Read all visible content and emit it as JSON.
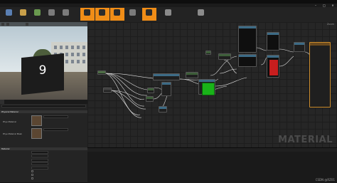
{
  "window": {
    "menu": [],
    "controls": [
      "–",
      "□",
      "✕"
    ]
  },
  "toolbar": {
    "buttons": [
      {
        "label": "",
        "icon": "save-icon"
      },
      {
        "label": "",
        "icon": "folder-icon"
      },
      {
        "label": "",
        "icon": "apply-icon"
      },
      {
        "label": "",
        "icon": "search-icon"
      },
      {
        "label": "",
        "icon": "home-icon"
      },
      {
        "label": "",
        "icon": "clean-icon"
      },
      {
        "label": "",
        "icon": "connectors-icon"
      },
      {
        "label": "",
        "icon": "live-preview-icon"
      },
      {
        "label": "",
        "icon": "live-nodes-icon"
      },
      {
        "label": "",
        "icon": "live-update-icon"
      },
      {
        "label": "",
        "icon": "hlsl-icon"
      },
      {
        "label": "",
        "icon": "platform-icon"
      }
    ],
    "accent_color": "#f08d17"
  },
  "viewport": {
    "chips": [
      "",
      "",
      ""
    ],
    "preview_number": "9"
  },
  "details": {
    "tabs": [
      "",
      ""
    ],
    "section_physical": "Physical Material",
    "prop_phys_material": "Phys Material",
    "prop_phys_material_value": "",
    "prop_phys_material_mask": "Phys Material Mask",
    "prop_phys_material_mask_value": "",
    "section_material": "Material",
    "material_props": [
      {
        "label": "",
        "value": ""
      },
      {
        "label": "",
        "value": ""
      },
      {
        "label": "",
        "value": ""
      },
      {
        "label": "",
        "value": ""
      },
      {
        "label": "",
        "value": ""
      },
      {
        "label": "",
        "value": ""
      },
      {
        "label": "",
        "value": ""
      },
      {
        "label": "",
        "value": ""
      }
    ]
  },
  "graph": {
    "zoom": "Zoom",
    "watermark": "MATERIAL",
    "nodes": [],
    "output_node_color": "#c98a2b",
    "green_preview": "#19b319",
    "red_preview": "#c81e1e"
  },
  "log": {
    "lines": [
      "",
      "",
      "",
      "",
      "",
      "",
      ""
    ],
    "credit": "CSDN @RZ01"
  }
}
